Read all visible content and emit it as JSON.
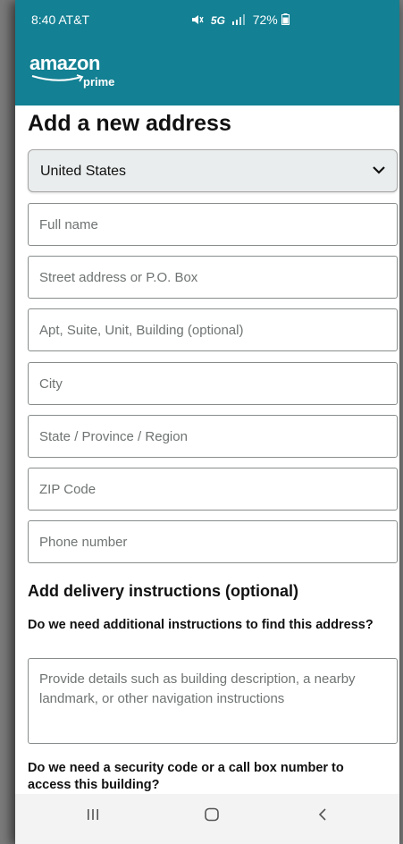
{
  "status_bar": {
    "time_carrier": "8:40 AT&T",
    "network": "5G",
    "battery": "72%"
  },
  "header": {
    "logo_text": "amazon",
    "logo_sub": "prime"
  },
  "page": {
    "title": "Add a new address"
  },
  "country_select": {
    "value": "United States"
  },
  "fields": {
    "full_name": "Full name",
    "street": "Street address or P.O. Box",
    "apt": "Apt, Suite, Unit, Building (optional)",
    "city": "City",
    "state": "State / Province / Region",
    "zip": "ZIP Code",
    "phone": "Phone number"
  },
  "delivery": {
    "title": "Add delivery instructions (optional)",
    "question1": "Do we need additional instructions to find this address?",
    "instructions_placeholder": "Provide details such as building description, a nearby landmark, or other navigation instructions",
    "question2": "Do we need a security code or a call box number to access this building?"
  },
  "navbar": {
    "recent": "recent-apps-icon",
    "home": "home-icon",
    "back": "back-icon"
  },
  "colors": {
    "header": "#138093",
    "select_bg": "#eaeded"
  }
}
